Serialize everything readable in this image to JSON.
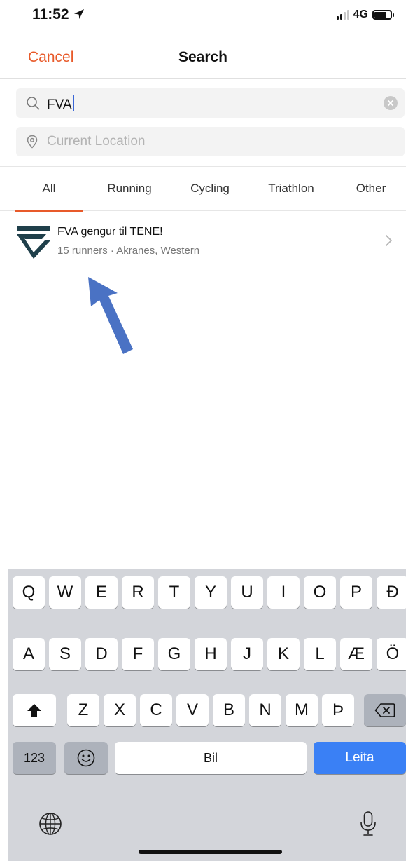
{
  "status_bar": {
    "time": "11:52",
    "network": "4G"
  },
  "nav": {
    "cancel_label": "Cancel",
    "title": "Search"
  },
  "search": {
    "value": "FVA",
    "location_placeholder": "Current Location"
  },
  "tabs": [
    {
      "label": "All",
      "selected": true
    },
    {
      "label": "Running",
      "selected": false
    },
    {
      "label": "Cycling",
      "selected": false
    },
    {
      "label": "Triathlon",
      "selected": false
    },
    {
      "label": "Other",
      "selected": false
    }
  ],
  "results": [
    {
      "title": "FVA gengur til TENE!",
      "subtitle": "15 runners · Akranes, Western",
      "logo_icon": "club-logo-icon"
    }
  ],
  "keyboard": {
    "row1": [
      "Q",
      "W",
      "E",
      "R",
      "T",
      "Y",
      "U",
      "I",
      "O",
      "P",
      "Ð"
    ],
    "row2": [
      "A",
      "S",
      "D",
      "F",
      "G",
      "H",
      "J",
      "K",
      "L",
      "Æ",
      "Ö"
    ],
    "row3": [
      "Z",
      "X",
      "C",
      "V",
      "B",
      "N",
      "M",
      "Þ"
    ],
    "numbers_label": "123",
    "space_label": "Bil",
    "go_label": "Leita"
  },
  "colors": {
    "accent": "#e85a2a",
    "primary_button": "#3a80f5",
    "annotation_arrow": "#4a72c4",
    "logo": "#1f3f4a"
  }
}
